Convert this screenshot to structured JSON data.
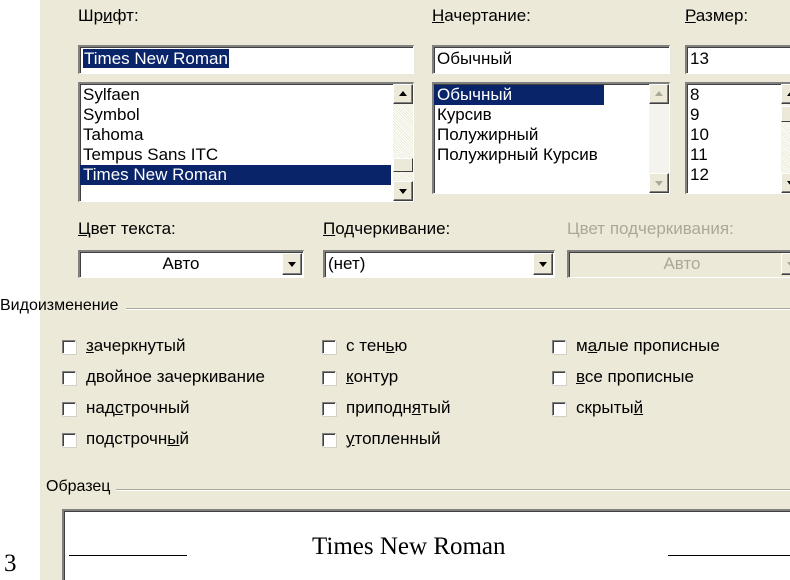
{
  "font_dialog": {
    "font": {
      "label_pre": "Шр",
      "label_ul": "и",
      "label_post": "фт:",
      "value": "Times New Roman",
      "list": [
        "Sylfaen",
        "Symbol",
        "Tahoma",
        "Tempus Sans ITC",
        "Times New Roman"
      ],
      "selected_index": 4
    },
    "style": {
      "label_ul": "Н",
      "label_post": "ачертание:",
      "value": "Обычный",
      "list": [
        "Обычный",
        "Курсив",
        "Полужирный",
        "Полужирный Курсив"
      ],
      "selected_index": 0
    },
    "size": {
      "label_ul": "Р",
      "label_post": "азмер:",
      "value": "13",
      "list": [
        "8",
        "9",
        "10",
        "11",
        "12"
      ]
    },
    "text_color": {
      "label_ul": "Ц",
      "label_post": "вет текста:",
      "value": "Авто"
    },
    "underline": {
      "label_ul": "П",
      "label_post": "одчеркивание:",
      "value": "(нет)"
    },
    "underline_color": {
      "label": "Цвет подчеркивания:",
      "value": "Авто"
    },
    "effects": {
      "title": "Видоизменение",
      "items": [
        {
          "pre": "",
          "ul": "з",
          "post": "ачеркнутый",
          "checked": false
        },
        {
          "pre": "",
          "ul": "д",
          "post": "войное зачеркивание",
          "checked": false
        },
        {
          "pre": "над",
          "ul": "с",
          "post": "трочный",
          "checked": false
        },
        {
          "pre": "подстрочн",
          "ul": "ы",
          "post": "й",
          "checked": false
        },
        {
          "pre": "с тен",
          "ul": "ь",
          "post": "ю",
          "checked": false
        },
        {
          "pre": "",
          "ul": "к",
          "post": "онтур",
          "checked": false
        },
        {
          "pre": "приподн",
          "ul": "я",
          "post": "тый",
          "checked": false
        },
        {
          "pre": "",
          "ul": "у",
          "post": "топленный",
          "checked": false
        },
        {
          "pre": "м",
          "ul": "а",
          "post": "лые прописные",
          "checked": false
        },
        {
          "pre": "",
          "ul": "в",
          "post": "се прописные",
          "checked": false
        },
        {
          "pre": "скрыты",
          "ul": "й",
          "post": "",
          "checked": false
        }
      ]
    },
    "sample": {
      "title": "Образец",
      "text": "Times New Roman"
    }
  },
  "page_number": "3",
  "colors": {
    "dialog_bg": "#ece9d8",
    "selection": "#0a246a",
    "disabled_text": "#aca899"
  }
}
